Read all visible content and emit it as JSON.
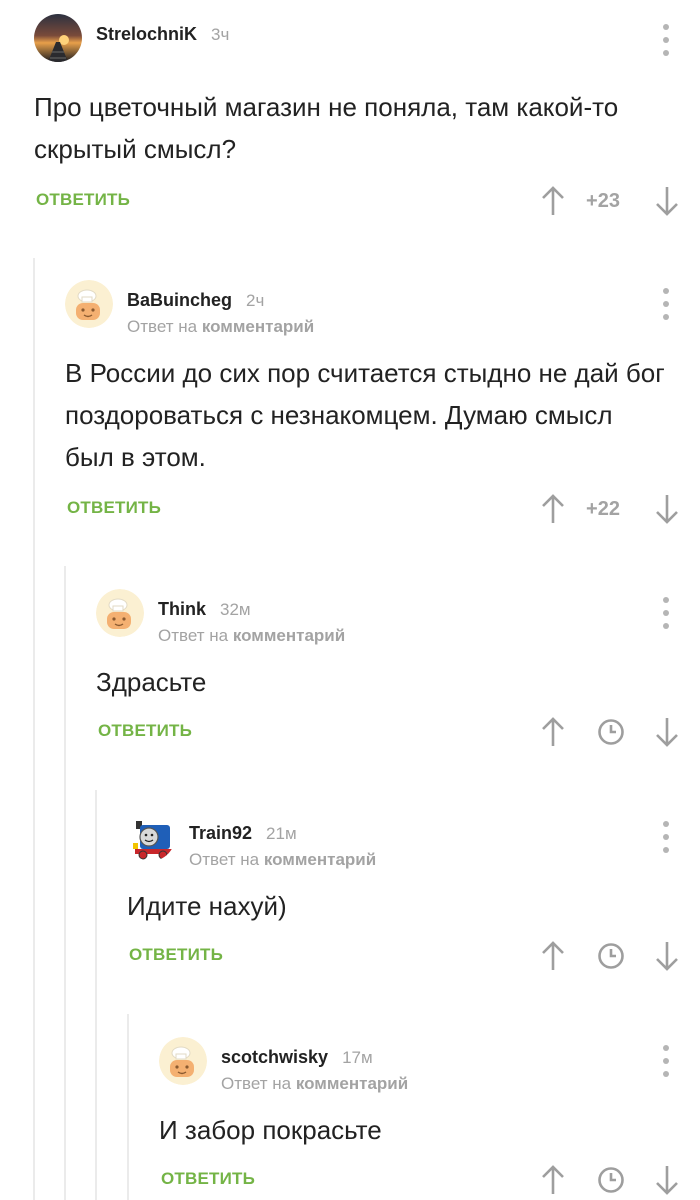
{
  "comments": [
    {
      "author": "StrelochniK",
      "time": "3ч",
      "reply_prefix": "",
      "reply_target": "",
      "text": "Про цветочный магазин не поняла, там какой-то скрытый смысл?",
      "reply_label": "ОТВЕТИТЬ",
      "rating": "+23"
    },
    {
      "author": "BaBuincheg",
      "time": "2ч",
      "reply_prefix": "Ответ на",
      "reply_target": "комментарий",
      "text": "В России до сих пор считается стыдно не дай бог поздороваться с незнакомцем. Думаю смысл был в этом.",
      "reply_label": "ОТВЕТИТЬ",
      "rating": "+22"
    },
    {
      "author": "Think",
      "time": "32м",
      "reply_prefix": "Ответ на",
      "reply_target": "комментарий",
      "text": "Здрасьте",
      "reply_label": "ОТВЕТИТЬ",
      "rating": ""
    },
    {
      "author": "Train92",
      "time": "21м",
      "reply_prefix": "Ответ на",
      "reply_target": "комментарий",
      "text": "Идите нахуй)",
      "reply_label": "ОТВЕТИТЬ",
      "rating": ""
    },
    {
      "author": "scotchwisky",
      "time": "17м",
      "reply_prefix": "Ответ на",
      "reply_target": "комментарий",
      "text": "И забор покрасьте",
      "reply_label": "ОТВЕТИТЬ",
      "rating": ""
    }
  ],
  "icons": {
    "vote_up": "arrow-up-icon",
    "vote_down": "arrow-down-icon",
    "rating_hidden": "clock-icon",
    "more": "more-vertical-icon"
  },
  "colors": {
    "reply_link": "#74b446",
    "meta_text": "#a3a3a3",
    "icon": "#9e9e9e",
    "thread_line": "#ebebeb"
  }
}
